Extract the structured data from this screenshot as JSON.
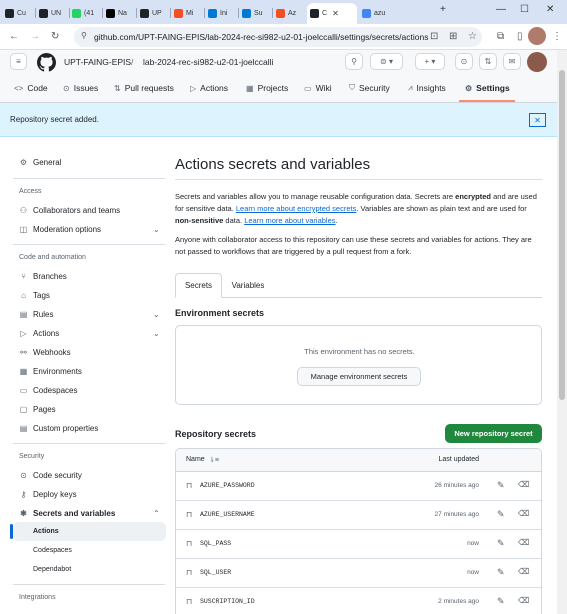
{
  "browser": {
    "tabs": [
      {
        "label": "Cu",
        "icon": "check-icon",
        "color": "#1f2328"
      },
      {
        "label": "UN",
        "icon": "check-icon",
        "color": "#1f2328"
      },
      {
        "label": "(41",
        "icon": "whatsapp-icon",
        "color": "#25d366"
      },
      {
        "label": "Na",
        "icon": "notion-icon",
        "color": "#000000"
      },
      {
        "label": "UP",
        "icon": "github-icon",
        "color": "#1f2328"
      },
      {
        "label": "Mi",
        "icon": "microsoft-icon",
        "color": "#f25022"
      },
      {
        "label": "Ini",
        "icon": "azure-icon",
        "color": "#0078d4"
      },
      {
        "label": "Su",
        "icon": "azure-icon",
        "color": "#0078d4"
      },
      {
        "label": "Az",
        "icon": "microsoft-icon",
        "color": "#f25022"
      },
      {
        "label": "C",
        "icon": "github-icon",
        "color": "#1f2328",
        "active": true
      },
      {
        "label": "azu",
        "icon": "google-icon",
        "color": "#4285f4"
      }
    ],
    "new_tab": "+",
    "url": "github.com/UPT-FAING-EPIS/lab-2024-rec-si982-u2-01-joelccalli/settings/secrets/actions"
  },
  "header": {
    "org": "UPT-FAING-EPIS",
    "separator": "/",
    "repo": "lab-2024-rec-si982-u2-01-joelccalli"
  },
  "repo_tabs": [
    {
      "label": "Code",
      "icon": "code-icon",
      "glyph": "<>"
    },
    {
      "label": "Issues",
      "icon": "issue-icon",
      "glyph": "⊙"
    },
    {
      "label": "Pull requests",
      "icon": "pull-request-icon",
      "glyph": "⇅"
    },
    {
      "label": "Actions",
      "icon": "play-icon",
      "glyph": "▷"
    },
    {
      "label": "Projects",
      "icon": "table-icon",
      "glyph": "▦"
    },
    {
      "label": "Wiki",
      "icon": "book-icon",
      "glyph": "▭"
    },
    {
      "label": "Security",
      "icon": "shield-icon",
      "glyph": "⛉"
    },
    {
      "label": "Insights",
      "icon": "graph-icon",
      "glyph": "⩘"
    },
    {
      "label": "Settings",
      "icon": "gear-icon",
      "glyph": "⚙",
      "selected": true
    }
  ],
  "flash": {
    "message": "Repository secret added.",
    "close": "✕"
  },
  "sidebar": {
    "general": "General",
    "access_heading": "Access",
    "collaborators": "Collaborators and teams",
    "moderation": "Moderation options",
    "code_heading": "Code and automation",
    "branches": "Branches",
    "tags": "Tags",
    "rules": "Rules",
    "actions": "Actions",
    "webhooks": "Webhooks",
    "environments": "Environments",
    "codespaces": "Codespaces",
    "pages": "Pages",
    "custom_properties": "Custom properties",
    "security_heading": "Security",
    "code_security": "Code security",
    "deploy_keys": "Deploy keys",
    "secrets_vars": "Secrets and variables",
    "sub_actions": "Actions",
    "sub_codespaces": "Codespaces",
    "sub_dependabot": "Dependabot",
    "integrations_heading": "Integrations"
  },
  "main": {
    "title": "Actions secrets and variables",
    "p1_a": "Secrets and variables allow you to manage reusable configuration data. Secrets are ",
    "p1_encrypted": "encrypted",
    "p1_b": " and are used for sensitive data. ",
    "p1_link1": "Learn more about encrypted secrets",
    "p1_c": ". Variables are shown as plain text and are used for ",
    "p1_nonsensitive": "non-sensitive",
    "p1_d": " data. ",
    "p1_link2": "Learn more about variables",
    "p1_e": ".",
    "p2": "Anyone with collaborator access to this repository can use these secrets and variables for actions. They are not passed to workflows that are triggered by a pull request from a fork.",
    "tab_secrets": "Secrets",
    "tab_variables": "Variables",
    "env_heading": "Environment secrets",
    "env_empty": "This environment has no secrets.",
    "env_button": "Manage environment secrets",
    "repo_heading": "Repository secrets",
    "new_button": "New repository secret",
    "col_name": "Name",
    "sort_glyph": "⇂≡",
    "col_updated": "Last updated",
    "secrets": [
      {
        "name": "AZURE_PASSWORD",
        "updated": "26 minutes ago"
      },
      {
        "name": "AZURE_USERNAME",
        "updated": "27 minutes ago"
      },
      {
        "name": "SQL_PASS",
        "updated": "now"
      },
      {
        "name": "SQL_USER",
        "updated": "now"
      },
      {
        "name": "SUSCRIPTION_ID",
        "updated": "2 minutes ago"
      }
    ]
  },
  "colors": {
    "accent": "#0969da",
    "primary_button": "#1f883d",
    "flash_bg": "#ddf4ff",
    "selected_tab_underline": "#fd8c73"
  }
}
